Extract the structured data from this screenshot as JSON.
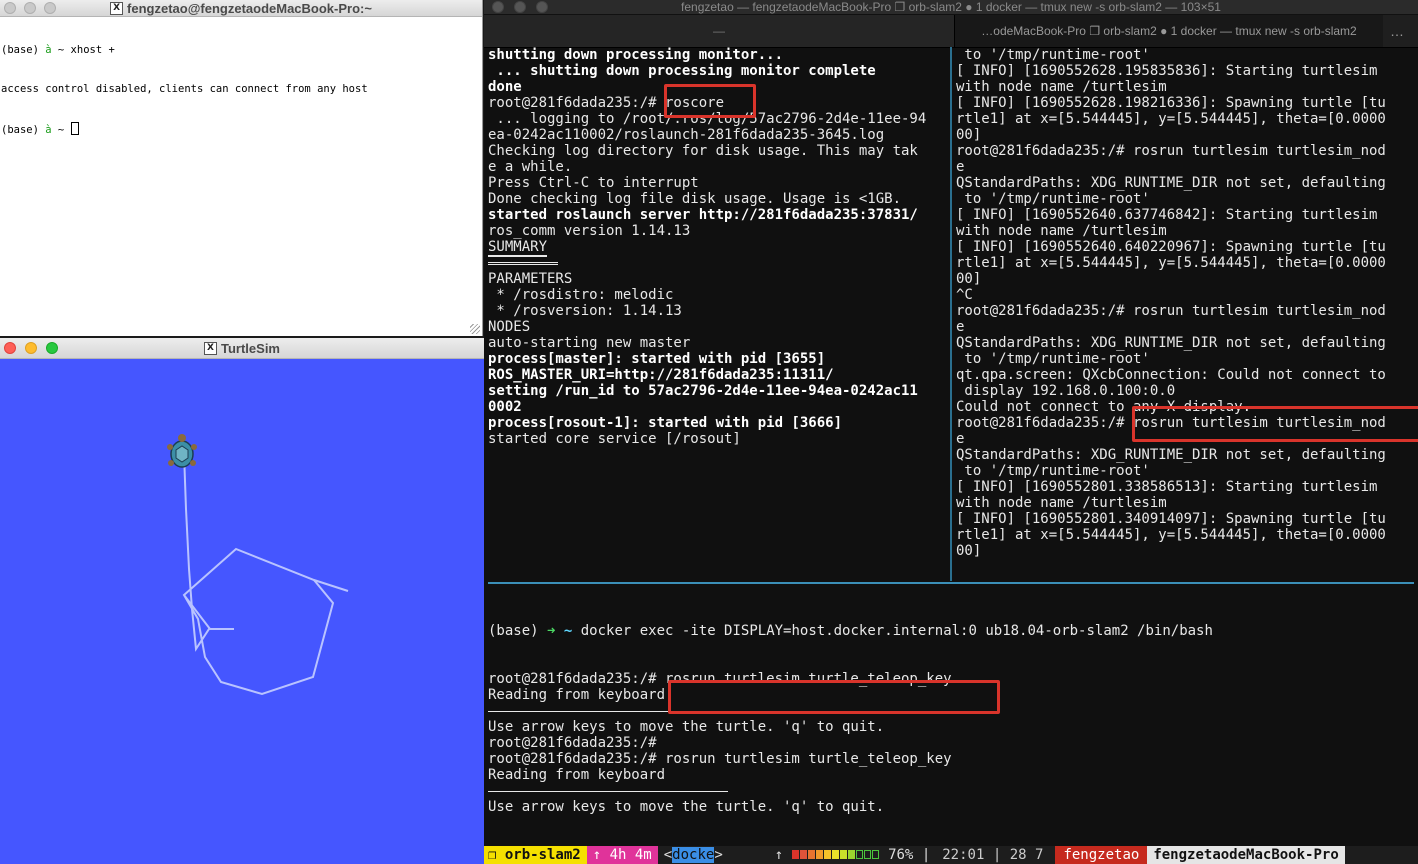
{
  "xterm": {
    "title": "fengzetao@fengzetaodeMacBook-Pro:~",
    "lines": [
      {
        "prefix": "(base) ",
        "arrow": "à",
        "rest": " ~ xhost +"
      },
      {
        "prefix": "access control disabled, clients can connect from any host",
        "arrow": "",
        "rest": ""
      },
      {
        "prefix": "(base) ",
        "arrow": "à",
        "rest": " ~ "
      }
    ]
  },
  "turtlesim": {
    "title": "TurtleSim",
    "background_color": "#4556ff"
  },
  "iterm": {
    "window_title": "fengzetao — fengzetaodeMacBook-Pro ❐ orb-slam2 ● 1 docker — tmux new -s orb-slam2 — 103×51",
    "tabs": [
      {
        "label": "—"
      },
      {
        "label": "…odeMacBook-Pro ❐ orb-slam2 ● 1 docker — tmux new -s orb-slam2"
      }
    ],
    "more": "…"
  },
  "pane_left": {
    "lines": [
      {
        "t": "shutting down processing monitor...",
        "style": "b"
      },
      {
        "t": " ... shutting down processing monitor complete",
        "style": "b"
      },
      {
        "t": "done",
        "style": "b"
      },
      {
        "t": "root@281f6dada235:/# roscore",
        "style": ""
      },
      {
        "t": " ... logging to /root/.ros/log/57ac2796-2d4e-11ee-94",
        "style": ""
      },
      {
        "t": "ea-0242ac110002/roslaunch-281f6dada235-3645.log",
        "style": ""
      },
      {
        "t": "Checking log directory for disk usage. This may tak",
        "style": ""
      },
      {
        "t": "e a while.",
        "style": ""
      },
      {
        "t": "Press Ctrl-C to interrupt",
        "style": ""
      },
      {
        "t": "Done checking log file disk usage. Usage is <1GB.",
        "style": ""
      },
      {
        "t": "",
        "style": ""
      },
      {
        "t": "started roslaunch server http://281f6dada235:37831/",
        "style": "b"
      },
      {
        "t": "ros_comm version 1.14.13",
        "style": ""
      },
      {
        "t": "",
        "style": ""
      },
      {
        "t": "",
        "style": ""
      },
      {
        "t": "SUMMARY",
        "style": "u"
      },
      {
        "t": "",
        "style": "rule"
      },
      {
        "t": "",
        "style": ""
      },
      {
        "t": "PARAMETERS",
        "style": ""
      },
      {
        "t": " * /rosdistro: melodic",
        "style": ""
      },
      {
        "t": " * /rosversion: 1.14.13",
        "style": ""
      },
      {
        "t": "",
        "style": ""
      },
      {
        "t": "NODES",
        "style": ""
      },
      {
        "t": "",
        "style": ""
      },
      {
        "t": "auto-starting new master",
        "style": ""
      },
      {
        "t": "process[master]: started with pid [3655]",
        "style": "b"
      },
      {
        "t": "ROS_MASTER_URI=http://281f6dada235:11311/",
        "style": "b"
      },
      {
        "t": "",
        "style": ""
      },
      {
        "t": "setting /run_id to 57ac2796-2d4e-11ee-94ea-0242ac11",
        "style": "b"
      },
      {
        "t": "0002",
        "style": "b"
      },
      {
        "t": "process[rosout-1]: started with pid [3666]",
        "style": "b"
      },
      {
        "t": "started core service [/rosout]",
        "style": ""
      }
    ]
  },
  "pane_right": {
    "lines": [
      " to '/tmp/runtime-root'",
      "[ INFO] [1690552628.195835836]: Starting turtlesim",
      "with node name /turtlesim",
      "[ INFO] [1690552628.198216336]: Spawning turtle [tu",
      "rtle1] at x=[5.544445], y=[5.544445], theta=[0.0000",
      "00]",
      "root@281f6dada235:/# rosrun turtlesim turtlesim_nod",
      "e",
      "QStandardPaths: XDG_RUNTIME_DIR not set, defaulting",
      " to '/tmp/runtime-root'",
      "[ INFO] [1690552640.637746842]: Starting turtlesim",
      "with node name /turtlesim",
      "[ INFO] [1690552640.640220967]: Spawning turtle [tu",
      "rtle1] at x=[5.544445], y=[5.544445], theta=[0.0000",
      "00]",
      "^C",
      "root@281f6dada235:/# rosrun turtlesim turtlesim_nod",
      "e",
      "QStandardPaths: XDG_RUNTIME_DIR not set, defaulting",
      " to '/tmp/runtime-root'",
      "qt.qpa.screen: QXcbConnection: Could not connect to",
      " display 192.168.0.100:0.0",
      "Could not connect to any X display.",
      "root@281f6dada235:/# rosrun turtlesim turtlesim_nod",
      "e",
      "QStandardPaths: XDG_RUNTIME_DIR not set, defaulting",
      " to '/tmp/runtime-root'",
      "[ INFO] [1690552801.338586513]: Starting turtlesim",
      "with node name /turtlesim",
      "[ INFO] [1690552801.340914097]: Spawning turtle [tu",
      "rtle1] at x=[5.544445], y=[5.544445], theta=[0.0000",
      "00]"
    ]
  },
  "pane_bottom": {
    "docker_line": {
      "prefix": "(base) ",
      "arrow": "➜",
      "tilde": "~",
      "cmd": " docker exec -ite DISPLAY=host.docker.internal:0 ub18.04-orb-slam2 /bin/bash"
    },
    "lines": [
      "root@281f6dada235:/# rosrun turtlesim turtle_teleop_key",
      "Reading from keyboard",
      "RULE",
      "Use arrow keys to move the turtle. 'q' to quit.",
      "root@281f6dada235:/#",
      "root@281f6dada235:/# rosrun turtlesim turtle_teleop_key",
      "Reading from keyboard",
      "RULE",
      "Use arrow keys to move the turtle. 'q' to quit."
    ]
  },
  "statusbar": {
    "session": "❐ orb-slam2",
    "uptime": "↑ 4h 4m",
    "window_open": "<",
    "window_name": "docke",
    "window_close": ">",
    "battery_arrow": "↑",
    "battery_percent": "76%",
    "battery_level": 0.76,
    "separator": "|",
    "time": "22:01",
    "day": "28",
    "month": "7",
    "user": "fengzetao",
    "host": "fengzetaodeMacBook-Pro"
  }
}
